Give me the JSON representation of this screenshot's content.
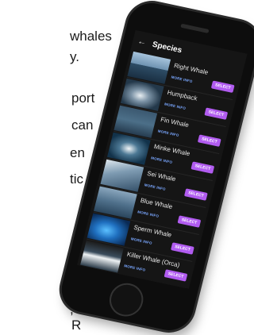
{
  "background_text": {
    "lines": [
      "whales",
      "y.",
      "port",
      "can",
      "en",
      "tic",
      "",
      ",",
      "R"
    ]
  },
  "app": {
    "header": {
      "back_icon": "arrow-left-icon",
      "title": "Species"
    },
    "more_info_label": "MORE INFO",
    "select_label": "SELECT",
    "accent_color": "#b15cf0",
    "link_color": "#7aa7ff",
    "species": [
      {
        "name": "Right Whale"
      },
      {
        "name": "Humpback"
      },
      {
        "name": "Fin Whale"
      },
      {
        "name": "Minke Whale"
      },
      {
        "name": "Sei Whale"
      },
      {
        "name": "Blue Whale"
      },
      {
        "name": "Sperm Whale"
      },
      {
        "name": "Killer Whale (Orca)"
      }
    ]
  }
}
